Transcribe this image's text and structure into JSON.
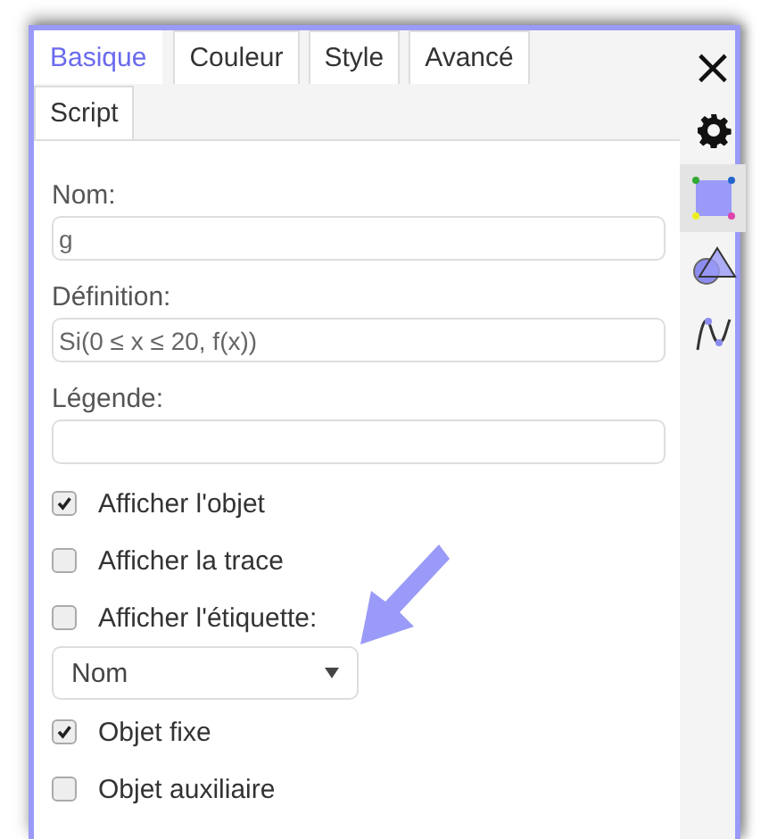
{
  "tabs": [
    {
      "label": "Basique",
      "selected": true
    },
    {
      "label": "Couleur",
      "selected": false
    },
    {
      "label": "Style",
      "selected": false
    },
    {
      "label": "Avancé",
      "selected": false
    },
    {
      "label": "Script",
      "selected": false
    }
  ],
  "side_icons": [
    {
      "kind": "close",
      "label": "×",
      "selected": false
    },
    {
      "kind": "gear",
      "selected": false
    },
    {
      "kind": "square",
      "selected": true
    },
    {
      "kind": "shapes",
      "selected": false
    },
    {
      "kind": "curve",
      "selected": false
    }
  ],
  "fields": [
    {
      "label": "Nom:",
      "value": "g"
    },
    {
      "label": "Définition:",
      "value": "Si(0 ≤ x ≤ 20, f(x))"
    },
    {
      "label": "Légende:"
    }
  ],
  "options": [
    {
      "kind": "checkbox",
      "label": "Afficher l'objet",
      "checked": true
    },
    {
      "kind": "checkbox",
      "label": "Afficher la trace",
      "checked": false
    },
    {
      "kind": "checkbox",
      "label": "Afficher l'étiquette:",
      "checked": false
    },
    {
      "kind": "dropdown",
      "value": "Nom"
    },
    {
      "kind": "checkbox",
      "label": "Objet fixe",
      "checked": true
    },
    {
      "kind": "checkbox",
      "label": "Objet auxiliaire",
      "checked": false
    }
  ]
}
